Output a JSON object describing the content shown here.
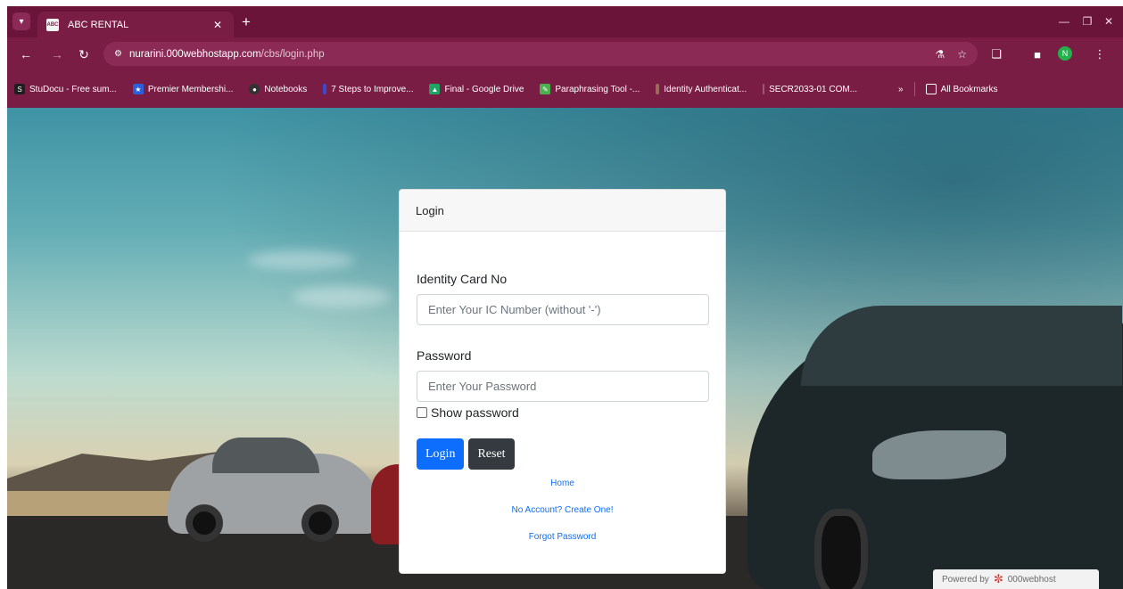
{
  "browser": {
    "tab": {
      "favicon_text": "ABC",
      "title": "ABC RENTAL"
    },
    "url": {
      "host": "nurarini.000webhostapp.com",
      "path": "/cbs/login.php"
    },
    "profile_initial": "N",
    "bookmarks": [
      {
        "label": "StuDocu - Free sum...",
        "color": "#1f1f1f"
      },
      {
        "label": "Premier Membershi...",
        "color": "#2b5fd9"
      },
      {
        "label": "Notebooks",
        "color": "#333333"
      },
      {
        "label": "7 Steps to Improve...",
        "color": "#3b4bd1"
      },
      {
        "label": "Final - Google Drive",
        "color": "#1fa463"
      },
      {
        "label": "Paraphrasing Tool -...",
        "color": "#4caf50"
      },
      {
        "label": "Identity Authenticat...",
        "color": "#9a6a5a"
      },
      {
        "label": "SECR2033-01 COM...",
        "color": "#7a1d45"
      }
    ],
    "all_bookmarks_label": "All Bookmarks"
  },
  "login": {
    "header": "Login",
    "ic_label": "Identity Card No",
    "ic_placeholder": "Enter Your IC Number (without '-')",
    "password_label": "Password",
    "password_placeholder": "Enter Your Password",
    "show_password_label": "Show password",
    "login_button": "Login",
    "reset_button": "Reset",
    "links": {
      "home": "Home",
      "create_account": "No Account? Create One!",
      "forgot_password": "Forgot Password"
    }
  },
  "hosting_badge": {
    "prefix": "Powered by",
    "brand": "000webhost"
  }
}
